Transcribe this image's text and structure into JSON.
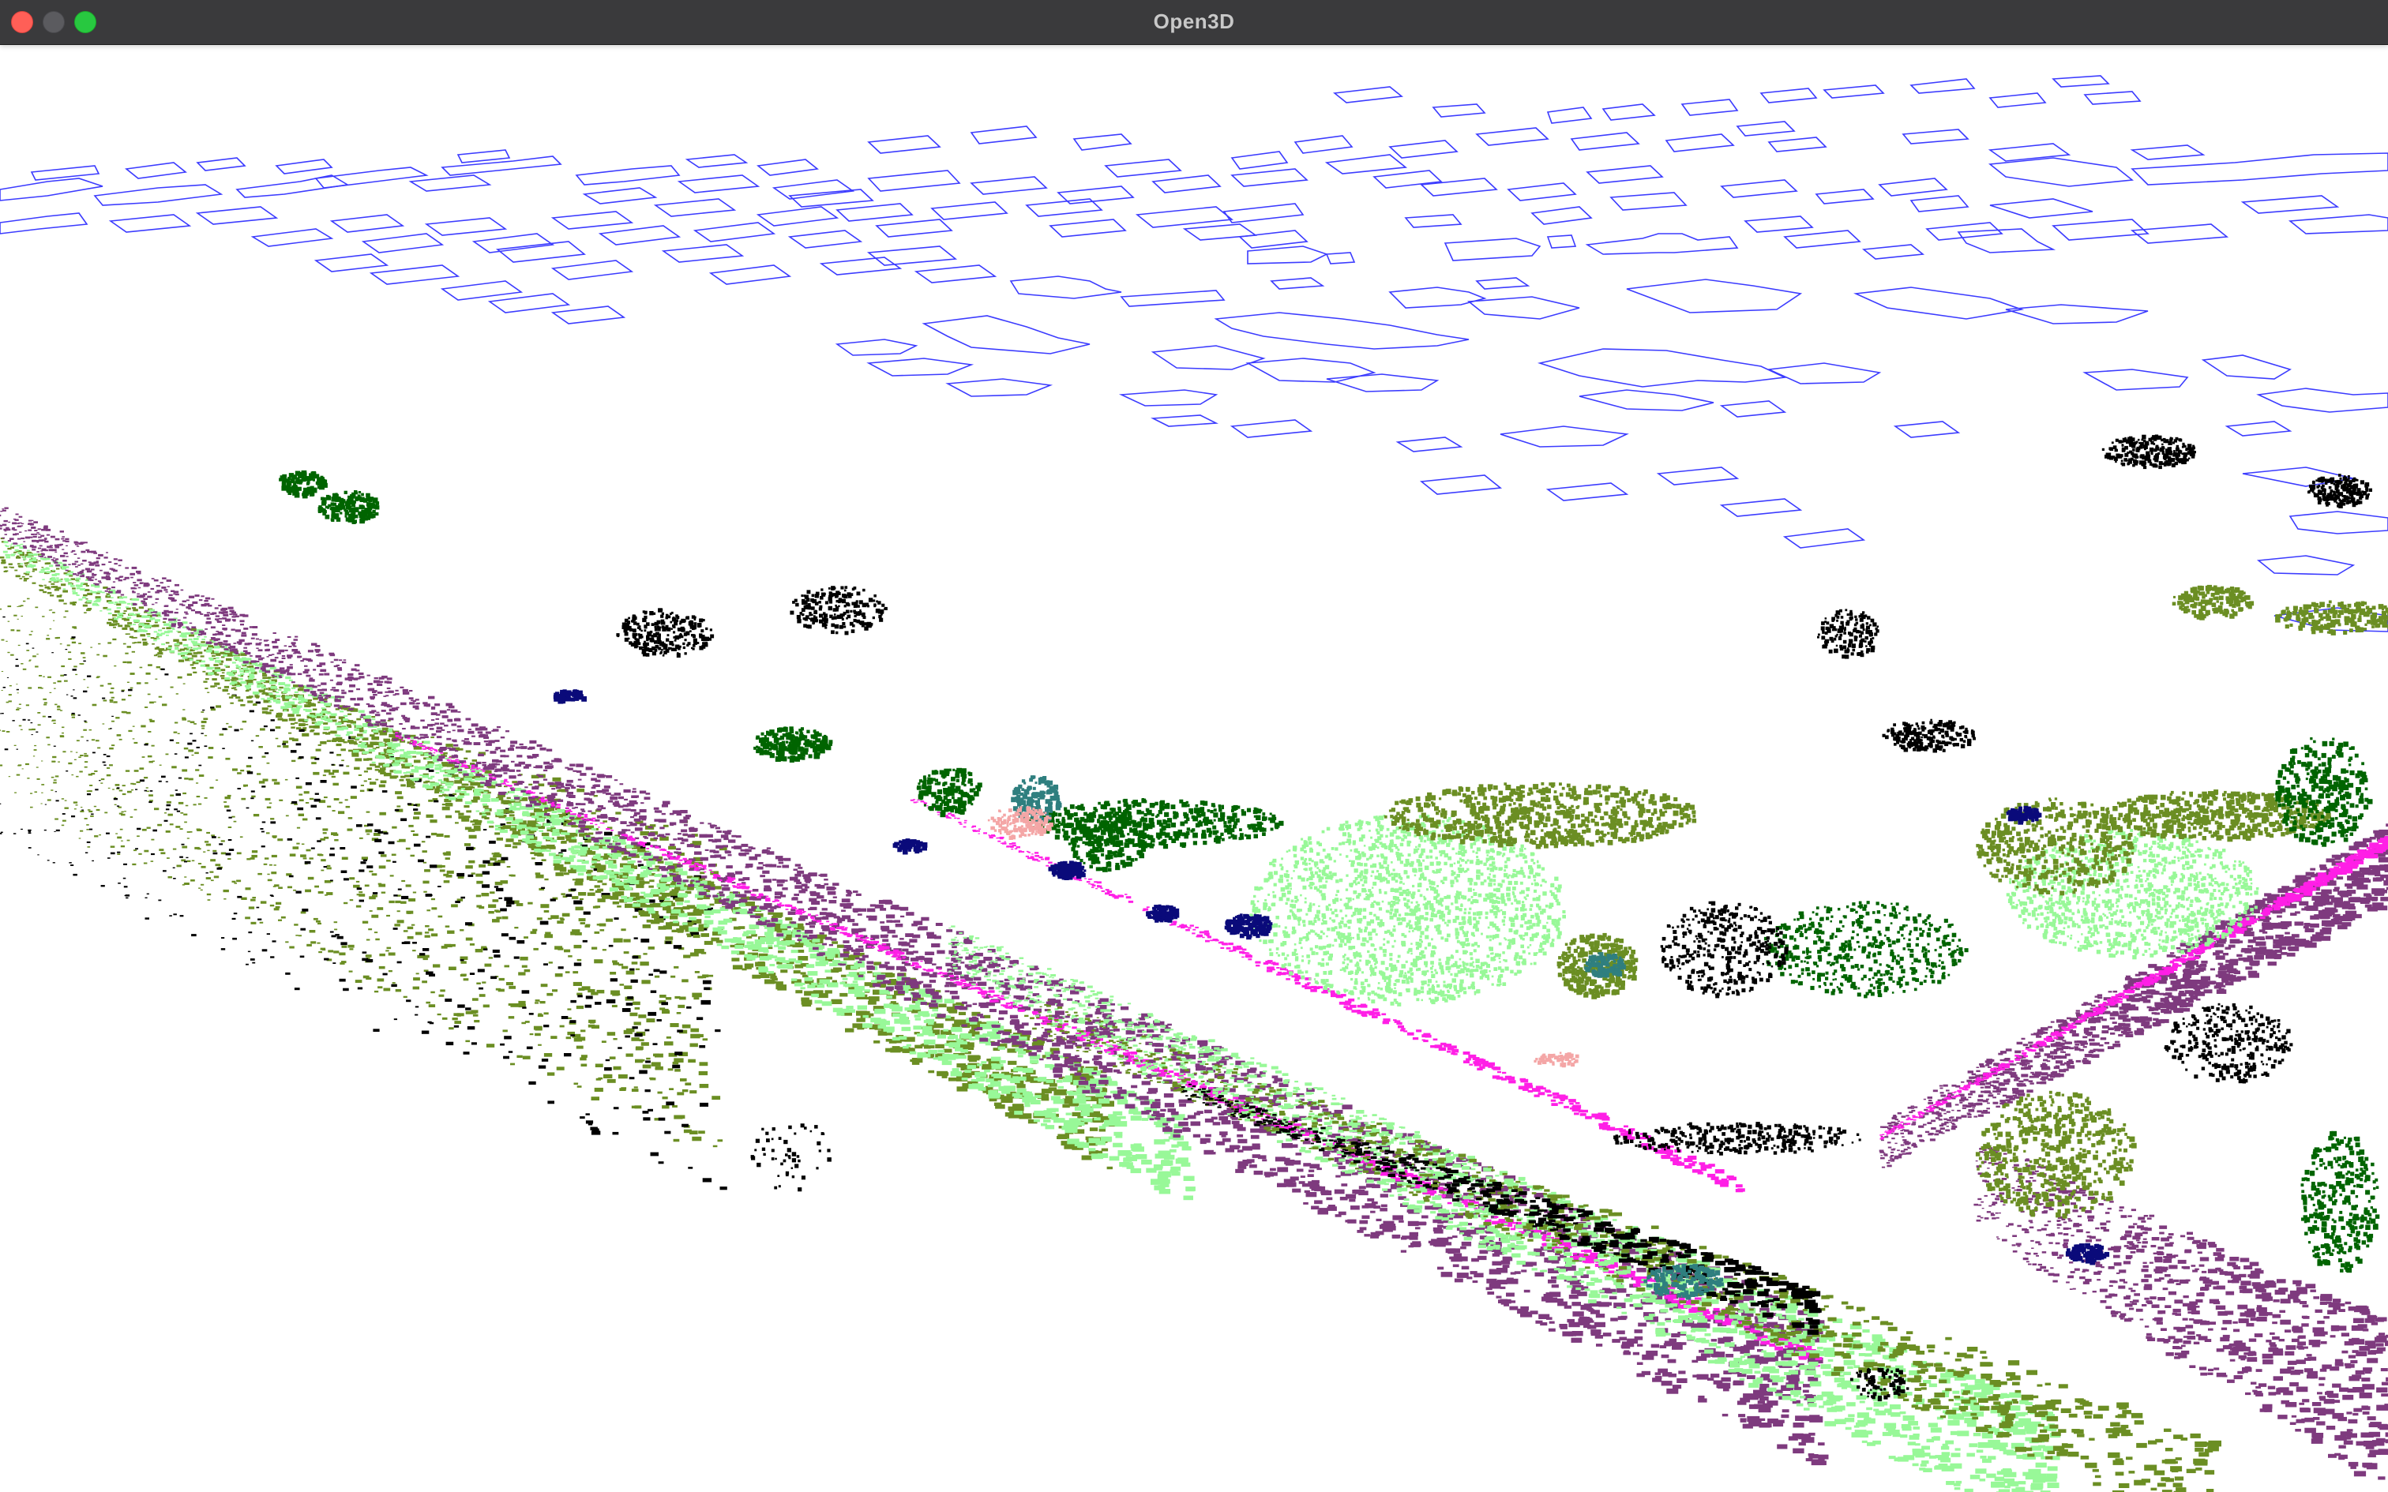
{
  "window": {
    "title": "Open3D"
  },
  "scene": {
    "background": "#ffffff",
    "footprint_color": "#3b3bff",
    "legend_colors": {
      "vegetation": "#6b8e23",
      "road": "#7e3a7e",
      "road_marking": "#ff1fe6",
      "sidewalk": "#98f898",
      "tree": "#006400",
      "car": "#0a0a7a",
      "unlabeled": "#000000",
      "building": "#2f7f7f",
      "ground_misc": "#f4a6a6"
    }
  },
  "icons": {
    "close": "close-dot-icon",
    "minimize": "minimize-dot-icon",
    "zoom": "zoom-dot-icon"
  }
}
